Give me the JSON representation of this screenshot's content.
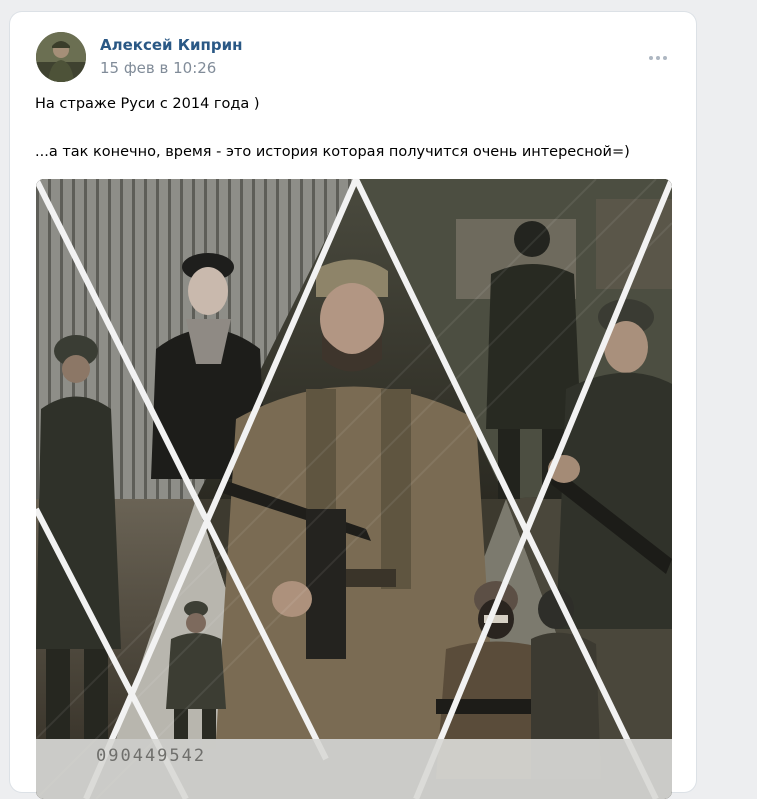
{
  "post": {
    "author": "Алексей Киприн",
    "timestamp": "15 фев в 10:26",
    "text_line1": "На страже Руси с 2014 года )",
    "text_line2": "...а так конечно, время - это история которая получится очень интересной=)",
    "image_caption_number": "090449542"
  },
  "icons": {
    "menu": "more-horizontal-icon"
  },
  "colors": {
    "author_link": "#2a5885",
    "timestamp": "#818c99",
    "page_bg": "#edeef0"
  }
}
